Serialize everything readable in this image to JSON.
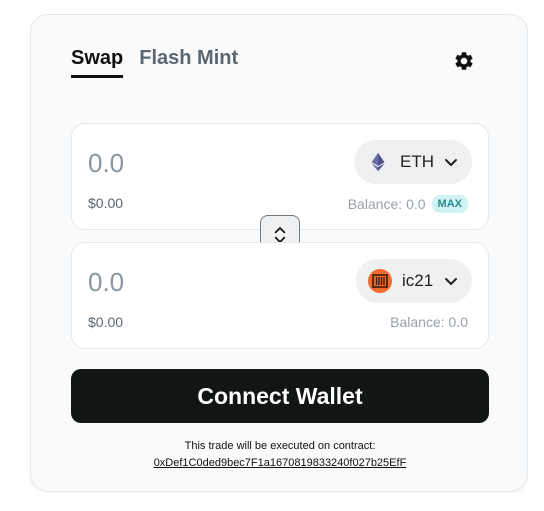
{
  "tabs": [
    {
      "label": "Swap",
      "active": true
    },
    {
      "label": "Flash Mint",
      "active": false
    }
  ],
  "input_panel": {
    "amount_placeholder": "0.0",
    "usd_value": "$0.00",
    "token": {
      "symbol": "ETH",
      "icon": "ethereum-icon"
    },
    "balance": "Balance: 0.0",
    "max_label": "MAX"
  },
  "output_panel": {
    "amount_placeholder": "0.0",
    "usd_value": "$0.00",
    "token": {
      "symbol": "ic21",
      "icon": "ic21-token-icon"
    },
    "balance": "Balance: 0.0"
  },
  "connect_button_label": "Connect Wallet",
  "contract": {
    "note": "This trade will be executed on contract:",
    "address": "0xDef1C0ded9bec7F1a1670819833240f027b25EfF"
  },
  "colors": {
    "primary_button": "#121515",
    "max_badge_bg": "#d2f3f4",
    "max_badge_text": "#2b8b95",
    "ic21_orange": "#f26a2e"
  }
}
